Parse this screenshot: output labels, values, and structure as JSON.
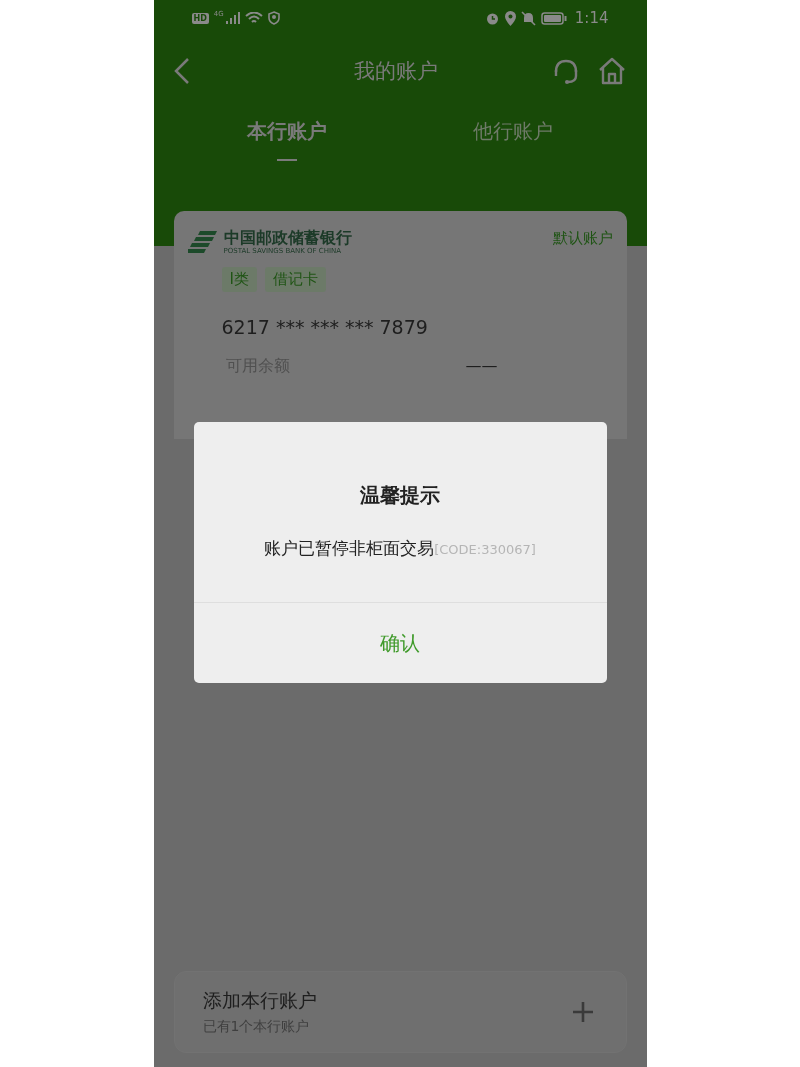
{
  "status_bar": {
    "badges": [
      "HD",
      "4G"
    ],
    "time": "1:14"
  },
  "header": {
    "title": "我的账户"
  },
  "tabs": [
    {
      "label": "本行账户",
      "selected": true
    },
    {
      "label": "他行账户",
      "selected": false
    }
  ],
  "account_card": {
    "bank_name": "中国邮政储蓄银行",
    "bank_name_en": "POSTAL SAVINGS BANK OF CHINA",
    "default_label": "默认账户",
    "tags": [
      "I类",
      "借记卡"
    ],
    "card_number": "6217 *** *** *** 7879",
    "balance_label": "可用余额",
    "balance": "——"
  },
  "add_account": {
    "title": "添加本行账户",
    "subtitle": "已有1个本行账户"
  },
  "dialog": {
    "title": "温馨提示",
    "message": "账户已暂停非柜面交易",
    "code": "[CODE:330067]",
    "button": "确认"
  }
}
